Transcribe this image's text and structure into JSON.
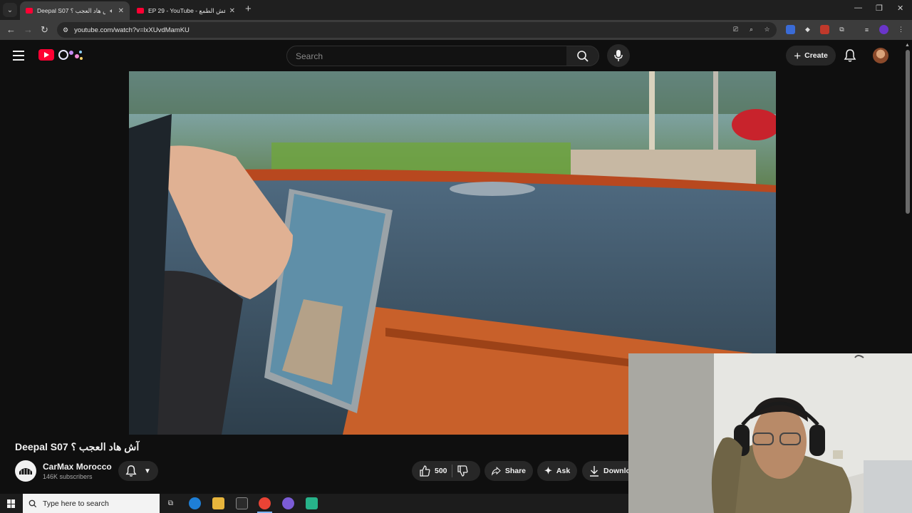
{
  "browser": {
    "tabs": [
      {
        "title": "Deepal S07 آش هاد العجب ؟",
        "active": true,
        "audio": true
      },
      {
        "title": "EP 29 - YouTube - عش الطمع",
        "active": false,
        "audio": false
      }
    ],
    "new_tab_symbol": "+",
    "url": "youtube.com/watch?v=lxXUvdMamKU",
    "window_controls": {
      "minimize": "—",
      "restore": "❐",
      "close": "✕"
    }
  },
  "youtube": {
    "search_placeholder": "Search",
    "create_label": "Create",
    "video": {
      "title": "Deepal S07 آش هاد العجب ؟",
      "channel": "CarMax Morocco",
      "subscribers": "146K subscribers",
      "likes": "500",
      "share_label": "Share",
      "ask_label": "Ask",
      "download_label": "Download"
    }
  },
  "taskbar": {
    "search_placeholder": "Type here to search"
  },
  "icons": [
    "hamburger-icon",
    "youtube-logo-icon",
    "search-icon",
    "mic-icon",
    "plus-icon",
    "bell-icon",
    "like-icon",
    "dislike-icon",
    "share-icon",
    "sparkle-icon",
    "download-icon",
    "windows-icon"
  ],
  "colors": {
    "brand_red": "#ff0033",
    "background": "#0f0f0f",
    "pill": "#272727"
  }
}
